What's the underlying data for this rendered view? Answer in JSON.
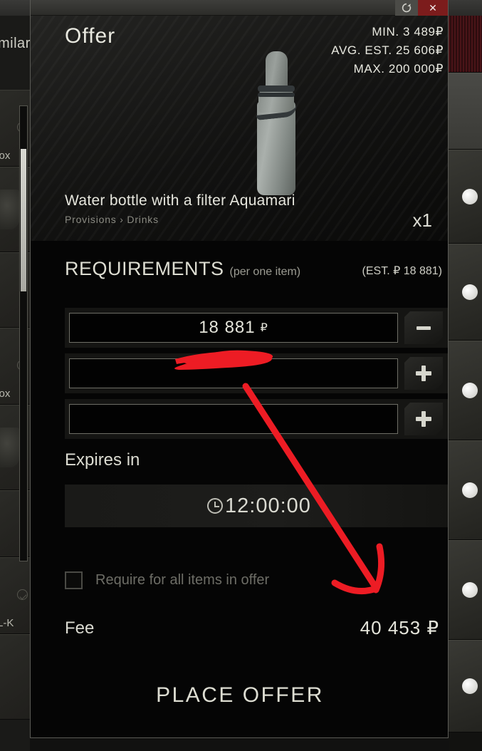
{
  "window": {
    "titlebar": {
      "refresh_icon": "refresh-icon",
      "refresh_glyph": "↻",
      "close_icon": "close-icon",
      "close_glyph": "✕"
    }
  },
  "background": {
    "left_panel_title": "milar",
    "left_rows": [
      {
        "label": "tbox",
        "has_check": true,
        "has_thumb": false
      },
      {
        "label": "",
        "has_check": false,
        "has_thumb": true
      },
      {
        "label": "",
        "has_check": false,
        "has_thumb": false
      },
      {
        "label": "tbox",
        "has_check": true,
        "has_thumb": false
      },
      {
        "label": "",
        "has_check": false,
        "has_thumb": true
      },
      {
        "label": "",
        "has_check": false,
        "has_thumb": false
      },
      {
        "label": "EL-K",
        "has_check": true,
        "has_thumb": false
      }
    ]
  },
  "dialog": {
    "title": "Offer",
    "prices": {
      "min": "MIN. 3 489",
      "avg": "AVG. EST. 25 606",
      "max": "MAX. 200 000",
      "currency": "₽"
    },
    "item": {
      "name": "Water bottle with a filter Aquamari",
      "breadcrumb": "Provisions › Drinks",
      "quantity": "x1",
      "image": "water-bottle-image"
    },
    "requirements": {
      "title": "REQUIREMENTS",
      "subtitle": "(per one item)",
      "estimate": "(EST. ₽ 18 881)",
      "rows": [
        {
          "value": "18 881",
          "currency": "₽",
          "button": "minus",
          "placeholder": ""
        },
        {
          "value": "",
          "currency": "",
          "button": "plus",
          "placeholder": ""
        },
        {
          "value": "",
          "currency": "",
          "button": "plus",
          "placeholder": ""
        }
      ]
    },
    "expires": {
      "label": "Expires in",
      "time": "12:00:00",
      "icon": "clock-icon"
    },
    "require_all": {
      "label": "Require for all items in offer",
      "checked": false
    },
    "fee": {
      "label": "Fee",
      "value": "40 453 ₽"
    },
    "place_offer": "PLACE OFFER"
  },
  "annotation": {
    "color": "#ED1C24",
    "scribble": "red-scribble-over-second-requirement-row",
    "arrow": "red-arrow-pointing-to-fee-value"
  }
}
